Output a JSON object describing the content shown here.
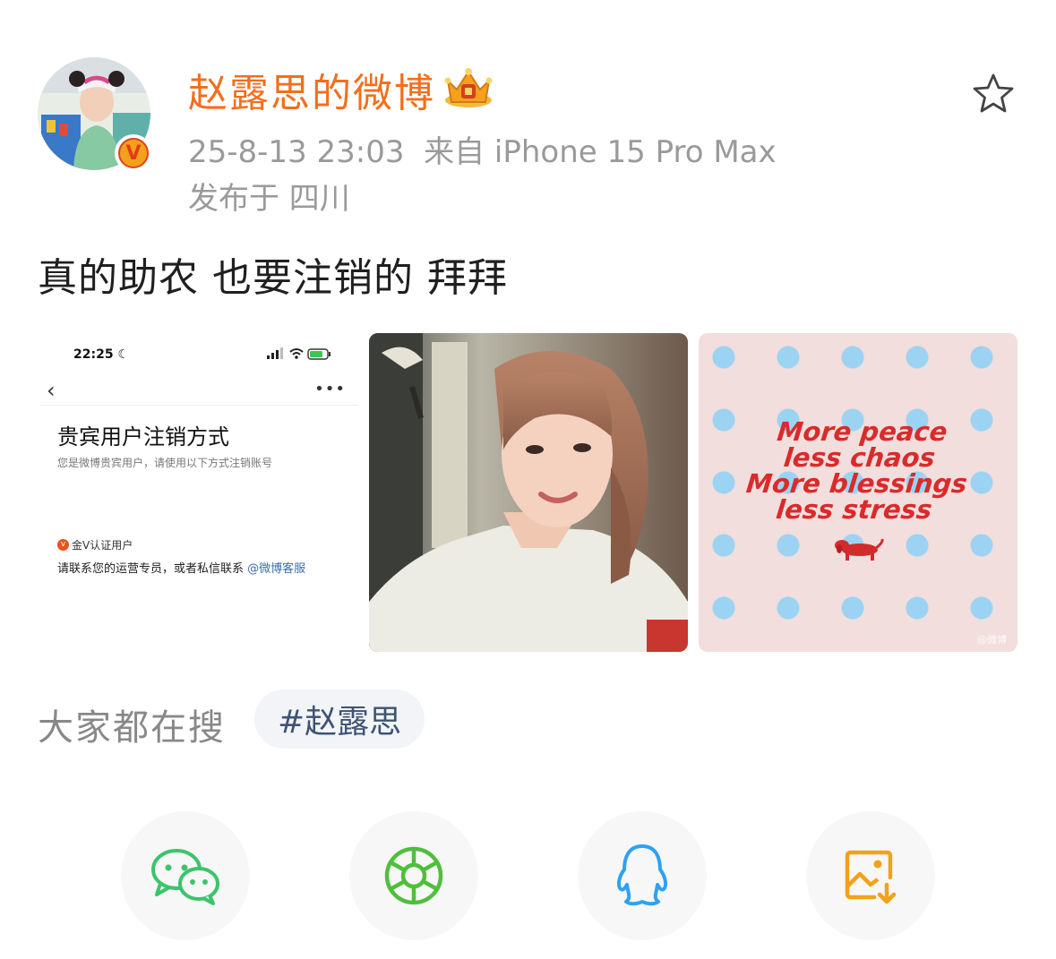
{
  "user": {
    "name": "赵露思的微博",
    "verified_badge": "V",
    "crown_icon": "gold-crown-icon"
  },
  "post": {
    "time": "25-8-13 23:03",
    "source": "来自 iPhone 15 Pro Max",
    "location": "发布于 四川",
    "text": "真的助农 也要注销的 拜拜"
  },
  "images": {
    "screenshot": {
      "status_time": "22:25",
      "title": "贵宾用户注销方式",
      "subtitle": "您是微博贵宾用户，请使用以下方式注销账号",
      "gold_v_label": "金V认证用户",
      "contact_text": "请联系您的运营专员，或者私信联系",
      "contact_link": "@微博客服"
    },
    "poster": {
      "lines": [
        "More peace",
        "less chaos",
        "More blessings",
        "less stress"
      ],
      "watermark": "@微博"
    }
  },
  "hot_search": {
    "label": "大家都在搜",
    "tag": "#赵露思"
  },
  "share": {
    "items": [
      "wechat-icon",
      "moments-icon",
      "qq-icon",
      "save-image-icon"
    ]
  },
  "colors": {
    "username": "#f36e1d",
    "meta": "#9a9a9a",
    "wechat": "#3cc46b",
    "moments": "#4fbf3b",
    "qq": "#2ea1f2",
    "save": "#f2a21a"
  }
}
